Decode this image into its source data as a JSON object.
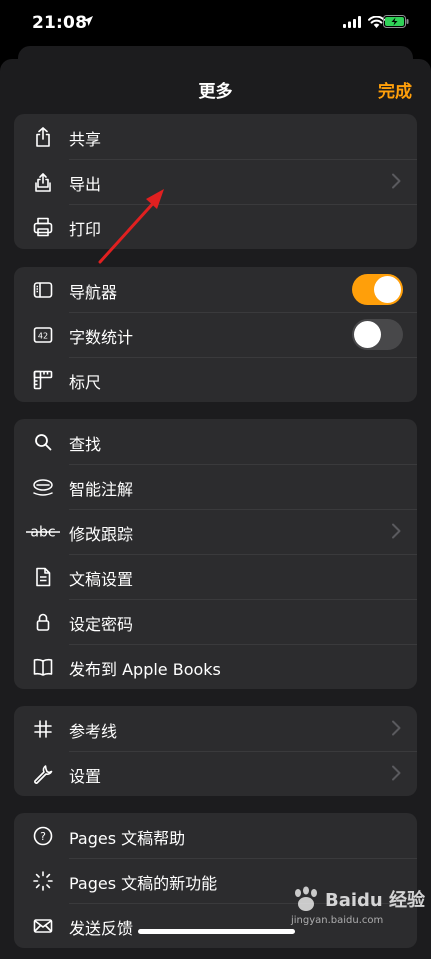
{
  "status": {
    "time": "21:08"
  },
  "sheet": {
    "title": "更多",
    "done_label": "完成"
  },
  "groups": [
    {
      "items": [
        {
          "label": "共享",
          "icon": "share-icon"
        },
        {
          "label": "导出",
          "icon": "export-icon",
          "chevron": true
        },
        {
          "label": "打印",
          "icon": "printer-icon"
        }
      ]
    },
    {
      "items": [
        {
          "label": "导航器",
          "icon": "navigator-icon",
          "toggle": true
        },
        {
          "label": "字数统计",
          "icon": "word-count-icon",
          "toggle": false
        },
        {
          "label": "标尺",
          "icon": "ruler-icon"
        }
      ]
    },
    {
      "items": [
        {
          "label": "查找",
          "icon": "search-icon"
        },
        {
          "label": "智能注解",
          "icon": "smart-annotation-icon"
        },
        {
          "label": "修改跟踪",
          "icon": "track-changes-icon",
          "chevron": true,
          "icon_text": "abc"
        },
        {
          "label": "文稿设置",
          "icon": "document-icon"
        },
        {
          "label": "设定密码",
          "icon": "lock-icon"
        },
        {
          "label": "发布到 Apple Books",
          "icon": "book-icon"
        }
      ]
    },
    {
      "items": [
        {
          "label": "参考线",
          "icon": "guides-icon",
          "chevron": true
        },
        {
          "label": "设置",
          "icon": "wrench-icon",
          "chevron": true
        }
      ]
    },
    {
      "items": [
        {
          "label": "Pages 文稿帮助",
          "icon": "help-icon"
        },
        {
          "label": "Pages 文稿的新功能",
          "icon": "whats-new-icon"
        },
        {
          "label": "发送反馈",
          "icon": "envelope-icon"
        }
      ]
    }
  ],
  "watermark": {
    "brand": "Baidu 经验",
    "url": "jingyan.baidu.com"
  },
  "colors": {
    "accent": "#ff9f0a",
    "sheet_bg": "#1c1c1e",
    "group_bg": "#2c2c2e",
    "annotation_arrow": "#e02020"
  }
}
